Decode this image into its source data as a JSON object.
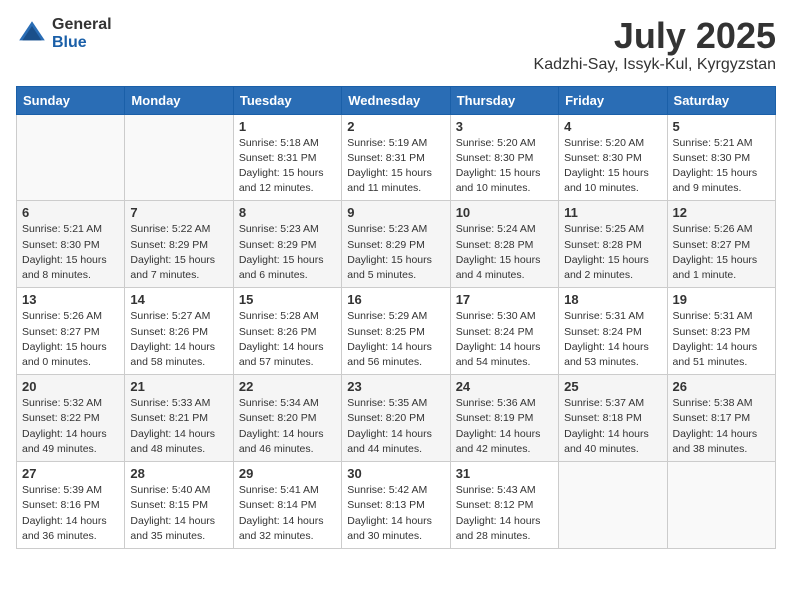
{
  "logo": {
    "general": "General",
    "blue": "Blue"
  },
  "title": "July 2025",
  "location": "Kadzhi-Say, Issyk-Kul, Kyrgyzstan",
  "headers": [
    "Sunday",
    "Monday",
    "Tuesday",
    "Wednesday",
    "Thursday",
    "Friday",
    "Saturday"
  ],
  "weeks": [
    [
      {
        "day": "",
        "info": ""
      },
      {
        "day": "",
        "info": ""
      },
      {
        "day": "1",
        "info": "Sunrise: 5:18 AM\nSunset: 8:31 PM\nDaylight: 15 hours and 12 minutes."
      },
      {
        "day": "2",
        "info": "Sunrise: 5:19 AM\nSunset: 8:31 PM\nDaylight: 15 hours and 11 minutes."
      },
      {
        "day": "3",
        "info": "Sunrise: 5:20 AM\nSunset: 8:30 PM\nDaylight: 15 hours and 10 minutes."
      },
      {
        "day": "4",
        "info": "Sunrise: 5:20 AM\nSunset: 8:30 PM\nDaylight: 15 hours and 10 minutes."
      },
      {
        "day": "5",
        "info": "Sunrise: 5:21 AM\nSunset: 8:30 PM\nDaylight: 15 hours and 9 minutes."
      }
    ],
    [
      {
        "day": "6",
        "info": "Sunrise: 5:21 AM\nSunset: 8:30 PM\nDaylight: 15 hours and 8 minutes."
      },
      {
        "day": "7",
        "info": "Sunrise: 5:22 AM\nSunset: 8:29 PM\nDaylight: 15 hours and 7 minutes."
      },
      {
        "day": "8",
        "info": "Sunrise: 5:23 AM\nSunset: 8:29 PM\nDaylight: 15 hours and 6 minutes."
      },
      {
        "day": "9",
        "info": "Sunrise: 5:23 AM\nSunset: 8:29 PM\nDaylight: 15 hours and 5 minutes."
      },
      {
        "day": "10",
        "info": "Sunrise: 5:24 AM\nSunset: 8:28 PM\nDaylight: 15 hours and 4 minutes."
      },
      {
        "day": "11",
        "info": "Sunrise: 5:25 AM\nSunset: 8:28 PM\nDaylight: 15 hours and 2 minutes."
      },
      {
        "day": "12",
        "info": "Sunrise: 5:26 AM\nSunset: 8:27 PM\nDaylight: 15 hours and 1 minute."
      }
    ],
    [
      {
        "day": "13",
        "info": "Sunrise: 5:26 AM\nSunset: 8:27 PM\nDaylight: 15 hours and 0 minutes."
      },
      {
        "day": "14",
        "info": "Sunrise: 5:27 AM\nSunset: 8:26 PM\nDaylight: 14 hours and 58 minutes."
      },
      {
        "day": "15",
        "info": "Sunrise: 5:28 AM\nSunset: 8:26 PM\nDaylight: 14 hours and 57 minutes."
      },
      {
        "day": "16",
        "info": "Sunrise: 5:29 AM\nSunset: 8:25 PM\nDaylight: 14 hours and 56 minutes."
      },
      {
        "day": "17",
        "info": "Sunrise: 5:30 AM\nSunset: 8:24 PM\nDaylight: 14 hours and 54 minutes."
      },
      {
        "day": "18",
        "info": "Sunrise: 5:31 AM\nSunset: 8:24 PM\nDaylight: 14 hours and 53 minutes."
      },
      {
        "day": "19",
        "info": "Sunrise: 5:31 AM\nSunset: 8:23 PM\nDaylight: 14 hours and 51 minutes."
      }
    ],
    [
      {
        "day": "20",
        "info": "Sunrise: 5:32 AM\nSunset: 8:22 PM\nDaylight: 14 hours and 49 minutes."
      },
      {
        "day": "21",
        "info": "Sunrise: 5:33 AM\nSunset: 8:21 PM\nDaylight: 14 hours and 48 minutes."
      },
      {
        "day": "22",
        "info": "Sunrise: 5:34 AM\nSunset: 8:20 PM\nDaylight: 14 hours and 46 minutes."
      },
      {
        "day": "23",
        "info": "Sunrise: 5:35 AM\nSunset: 8:20 PM\nDaylight: 14 hours and 44 minutes."
      },
      {
        "day": "24",
        "info": "Sunrise: 5:36 AM\nSunset: 8:19 PM\nDaylight: 14 hours and 42 minutes."
      },
      {
        "day": "25",
        "info": "Sunrise: 5:37 AM\nSunset: 8:18 PM\nDaylight: 14 hours and 40 minutes."
      },
      {
        "day": "26",
        "info": "Sunrise: 5:38 AM\nSunset: 8:17 PM\nDaylight: 14 hours and 38 minutes."
      }
    ],
    [
      {
        "day": "27",
        "info": "Sunrise: 5:39 AM\nSunset: 8:16 PM\nDaylight: 14 hours and 36 minutes."
      },
      {
        "day": "28",
        "info": "Sunrise: 5:40 AM\nSunset: 8:15 PM\nDaylight: 14 hours and 35 minutes."
      },
      {
        "day": "29",
        "info": "Sunrise: 5:41 AM\nSunset: 8:14 PM\nDaylight: 14 hours and 32 minutes."
      },
      {
        "day": "30",
        "info": "Sunrise: 5:42 AM\nSunset: 8:13 PM\nDaylight: 14 hours and 30 minutes."
      },
      {
        "day": "31",
        "info": "Sunrise: 5:43 AM\nSunset: 8:12 PM\nDaylight: 14 hours and 28 minutes."
      },
      {
        "day": "",
        "info": ""
      },
      {
        "day": "",
        "info": ""
      }
    ]
  ]
}
